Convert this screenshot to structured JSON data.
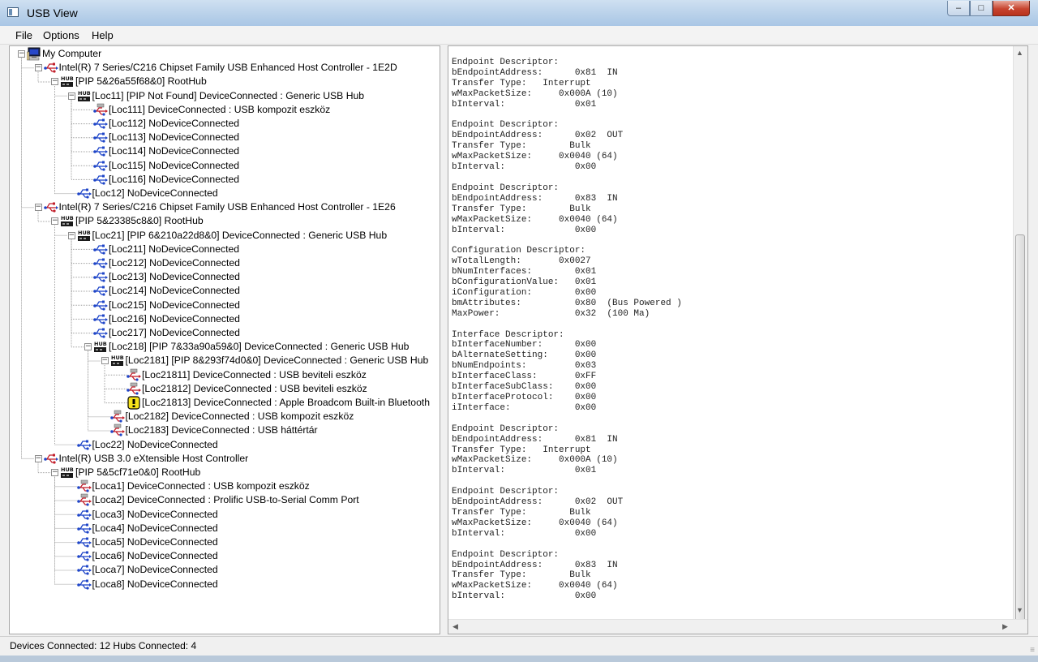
{
  "window": {
    "title": "USB View",
    "controls": {
      "minimize": "–",
      "maximize": "□",
      "close": "✕"
    }
  },
  "menu": [
    "File",
    "Options",
    "Help"
  ],
  "tree": [
    {
      "depth": 0,
      "icon": "computer-icon",
      "label": "My Computer",
      "expander": "minus"
    },
    {
      "depth": 1,
      "icon": "usb-controller-icon",
      "label": "Intel(R) 7 Series/C216 Chipset Family USB Enhanced Host Controller - 1E2D",
      "expander": "minus"
    },
    {
      "depth": 2,
      "icon": "hub-icon",
      "label": "[PIP 5&26a55f68&0] RootHub",
      "expander": "minus"
    },
    {
      "depth": 3,
      "icon": "hub-icon",
      "label": "[Loc11] [PIP Not Found] DeviceConnected :  Generic USB Hub",
      "expander": "minus"
    },
    {
      "depth": 4,
      "icon": "usb-device-icon",
      "label": "[Loc111] DeviceConnected :  USB kompozit eszköz"
    },
    {
      "depth": 4,
      "icon": "usb-port-icon",
      "label": "[Loc112] NoDeviceConnected"
    },
    {
      "depth": 4,
      "icon": "usb-port-icon",
      "label": "[Loc113] NoDeviceConnected"
    },
    {
      "depth": 4,
      "icon": "usb-port-icon",
      "label": "[Loc114] NoDeviceConnected"
    },
    {
      "depth": 4,
      "icon": "usb-port-icon",
      "label": "[Loc115] NoDeviceConnected"
    },
    {
      "depth": 4,
      "icon": "usb-port-icon",
      "label": "[Loc116] NoDeviceConnected"
    },
    {
      "depth": 3,
      "icon": "usb-port-icon",
      "label": "[Loc12] NoDeviceConnected"
    },
    {
      "depth": 1,
      "icon": "usb-controller-icon",
      "label": "Intel(R) 7 Series/C216 Chipset Family USB Enhanced Host Controller - 1E26",
      "expander": "minus"
    },
    {
      "depth": 2,
      "icon": "hub-icon",
      "label": "[PIP 5&23385c8&0] RootHub",
      "expander": "minus"
    },
    {
      "depth": 3,
      "icon": "hub-icon",
      "label": "[Loc21] [PIP 6&210a22d8&0] DeviceConnected :  Generic USB Hub",
      "expander": "minus"
    },
    {
      "depth": 4,
      "icon": "usb-port-icon",
      "label": "[Loc211] NoDeviceConnected"
    },
    {
      "depth": 4,
      "icon": "usb-port-icon",
      "label": "[Loc212] NoDeviceConnected"
    },
    {
      "depth": 4,
      "icon": "usb-port-icon",
      "label": "[Loc213] NoDeviceConnected"
    },
    {
      "depth": 4,
      "icon": "usb-port-icon",
      "label": "[Loc214] NoDeviceConnected"
    },
    {
      "depth": 4,
      "icon": "usb-port-icon",
      "label": "[Loc215] NoDeviceConnected"
    },
    {
      "depth": 4,
      "icon": "usb-port-icon",
      "label": "[Loc216] NoDeviceConnected"
    },
    {
      "depth": 4,
      "icon": "usb-port-icon",
      "label": "[Loc217] NoDeviceConnected"
    },
    {
      "depth": 4,
      "icon": "hub-icon",
      "label": "[Loc218] [PIP 7&33a90a59&0] DeviceConnected :  Generic USB Hub",
      "expander": "minus"
    },
    {
      "depth": 5,
      "icon": "hub-icon",
      "label": "[Loc2181] [PIP 8&293f74d0&0] DeviceConnected :  Generic USB Hub",
      "expander": "minus"
    },
    {
      "depth": 6,
      "icon": "usb-device-icon",
      "label": "[Loc21811] DeviceConnected :  USB beviteli eszköz"
    },
    {
      "depth": 6,
      "icon": "usb-device-icon",
      "label": "[Loc21812] DeviceConnected :  USB beviteli eszköz"
    },
    {
      "depth": 6,
      "icon": "warning-device-icon",
      "label": "[Loc21813] DeviceConnected :  Apple Broadcom Built-in Bluetooth"
    },
    {
      "depth": 5,
      "icon": "usb-device-icon",
      "label": "[Loc2182] DeviceConnected :  USB kompozit eszköz"
    },
    {
      "depth": 5,
      "icon": "usb-device-icon",
      "label": "[Loc2183] DeviceConnected :  USB háttértár"
    },
    {
      "depth": 3,
      "icon": "usb-port-icon",
      "label": "[Loc22] NoDeviceConnected"
    },
    {
      "depth": 1,
      "icon": "usb-controller-icon",
      "label": "Intel(R) USB 3.0 eXtensible Host Controller",
      "expander": "minus"
    },
    {
      "depth": 2,
      "icon": "hub-icon",
      "label": "[PIP 5&5cf71e0&0] RootHub",
      "expander": "minus"
    },
    {
      "depth": 3,
      "icon": "usb-device-icon",
      "label": "[Loca1] DeviceConnected :  USB kompozit eszköz"
    },
    {
      "depth": 3,
      "icon": "usb-device-icon",
      "label": "[Loca2] DeviceConnected :  Prolific USB-to-Serial Comm Port"
    },
    {
      "depth": 3,
      "icon": "usb-port-icon",
      "label": "[Loca3] NoDeviceConnected"
    },
    {
      "depth": 3,
      "icon": "usb-port-icon",
      "label": "[Loca4] NoDeviceConnected"
    },
    {
      "depth": 3,
      "icon": "usb-port-icon",
      "label": "[Loca5] NoDeviceConnected"
    },
    {
      "depth": 3,
      "icon": "usb-port-icon",
      "label": "[Loca6] NoDeviceConnected"
    },
    {
      "depth": 3,
      "icon": "usb-port-icon",
      "label": "[Loca7] NoDeviceConnected"
    },
    {
      "depth": 3,
      "icon": "usb-port-icon",
      "label": "[Loca8] NoDeviceConnected"
    }
  ],
  "details": "Endpoint Descriptor:\nbEndpointAddress:      0x81  IN\nTransfer Type:   Interrupt\nwMaxPacketSize:     0x000A (10)\nbInterval:             0x01\n\nEndpoint Descriptor:\nbEndpointAddress:      0x02  OUT\nTransfer Type:        Bulk\nwMaxPacketSize:     0x0040 (64)\nbInterval:             0x00\n\nEndpoint Descriptor:\nbEndpointAddress:      0x83  IN\nTransfer Type:        Bulk\nwMaxPacketSize:     0x0040 (64)\nbInterval:             0x00\n\nConfiguration Descriptor:\nwTotalLength:       0x0027\nbNumInterfaces:        0x01\nbConfigurationValue:   0x01\niConfiguration:        0x00\nbmAttributes:          0x80  (Bus Powered )\nMaxPower:              0x32  (100 Ma)\n\nInterface Descriptor:\nbInterfaceNumber:      0x00\nbAlternateSetting:     0x00\nbNumEndpoints:         0x03\nbInterfaceClass:       0xFF\nbInterfaceSubClass:    0x00\nbInterfaceProtocol:    0x00\niInterface:            0x00\n\nEndpoint Descriptor:\nbEndpointAddress:      0x81  IN\nTransfer Type:   Interrupt\nwMaxPacketSize:     0x000A (10)\nbInterval:             0x01\n\nEndpoint Descriptor:\nbEndpointAddress:      0x02  OUT\nTransfer Type:        Bulk\nwMaxPacketSize:     0x0040 (64)\nbInterval:             0x00\n\nEndpoint Descriptor:\nbEndpointAddress:      0x83  IN\nTransfer Type:        Bulk\nwMaxPacketSize:     0x0040 (64)\nbInterval:             0x00",
  "scrollbar": {
    "up": "▲",
    "down": "▼",
    "left": "◀",
    "right": "▶",
    "grip": "≡"
  },
  "status": {
    "text": "Devices Connected: 12   Hubs Connected: 4"
  },
  "colors": {
    "titlebar": "#b9d1ea",
    "usb_blue": "#1e45c8",
    "device_red": "#c21f2b",
    "warning_yellow": "#f6e21c"
  }
}
